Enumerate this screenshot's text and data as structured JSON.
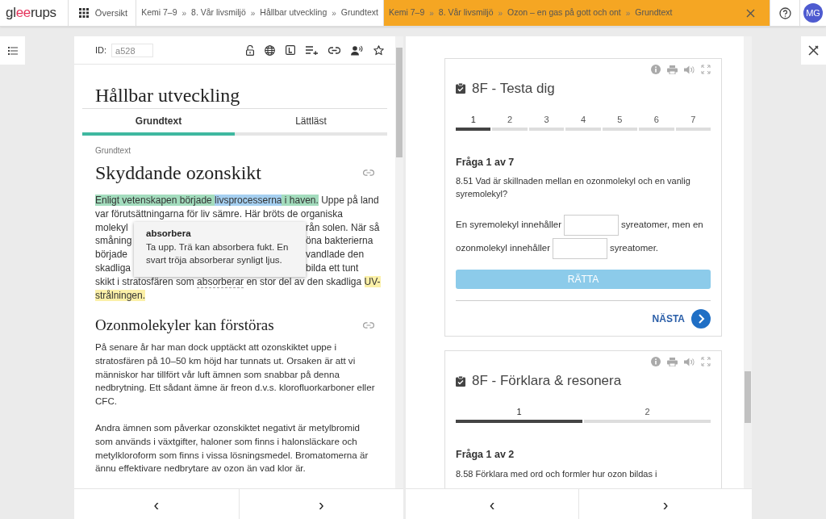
{
  "topbar": {
    "logo": [
      {
        "text": "gl",
        "accent": false
      },
      {
        "text": "ee",
        "accent": true
      },
      {
        "text": "rups",
        "accent": false
      }
    ],
    "overview": "Översikt",
    "trails": [
      {
        "active": false,
        "items": [
          {
            "kind": "crumb",
            "text": "Kemi 7–9"
          },
          {
            "kind": "sep",
            "text": "»"
          },
          {
            "kind": "crumb",
            "text": "8. Vår livsmiljö"
          },
          {
            "kind": "sep",
            "text": "»"
          },
          {
            "kind": "crumb",
            "text": "Hållbar utveckling"
          },
          {
            "kind": "sep",
            "text": "»"
          },
          {
            "kind": "crumb",
            "text": "Grundtext"
          }
        ]
      },
      {
        "active": true,
        "items": [
          {
            "kind": "crumb",
            "text": "Kemi 7–9"
          },
          {
            "kind": "sep",
            "text": "»"
          },
          {
            "kind": "crumb",
            "text": "8. Vår livsmiljö"
          },
          {
            "kind": "sep",
            "text": "»"
          },
          {
            "kind": "crumb",
            "text": "Ozon – en gas på gott och ont"
          },
          {
            "kind": "sep",
            "text": "»"
          },
          {
            "kind": "crumb",
            "text": "Grundtext"
          }
        ]
      }
    ],
    "avatar": "MG"
  },
  "reader": {
    "id_label": "ID:",
    "id_value": "a528",
    "title": "Hållbar utveckling",
    "tabs": [
      {
        "label": "Grundtext",
        "selected": true
      },
      {
        "label": "Lättläst",
        "selected": false
      }
    ],
    "section_label": "Grundtext",
    "heading_1": "Skyddande ozonskikt",
    "lines": [
      {
        "kind": "full",
        "segments": [
          {
            "kind": "highlight",
            "text": "Enligt vetenskapen började ",
            "color": "#a3dcbd"
          },
          {
            "kind": "highlight",
            "text": "livsprocesserna",
            "color": "#a5cff0"
          },
          {
            "kind": "highlight",
            "text": " i haven.",
            "color": "#a3dcbd"
          },
          {
            "kind": "plain",
            "text": " Uppe på land"
          }
        ]
      },
      {
        "kind": "full",
        "segments": [
          {
            "kind": "plain",
            "text": "var förutsättningarna för liv sämre. Här bröts de organiska"
          }
        ]
      },
      {
        "kind": "covered",
        "before": "molekyl",
        "after": "rån solen. När så"
      },
      {
        "kind": "covered",
        "before": "småning",
        "after": "öna bakterierna"
      },
      {
        "kind": "covered",
        "before": "började",
        "after": "vandlade den"
      },
      {
        "kind": "covered",
        "before": "skadliga",
        "after": "bilda ett tunt"
      },
      {
        "kind": "full",
        "segments": [
          {
            "kind": "plain",
            "text": "skikt i stratosfären som "
          },
          {
            "kind": "term",
            "text": "absorberar"
          },
          {
            "kind": "plain",
            "text": " en stor del av den skadliga "
          },
          {
            "kind": "highlight",
            "text": "UV-",
            "color": "#fbf0a8"
          }
        ]
      },
      {
        "kind": "full",
        "segments": [
          {
            "kind": "highlight",
            "text": "strålningen.",
            "color": "#fbf0a8"
          }
        ]
      }
    ],
    "tooltip": {
      "term": "absorbera",
      "text": "Ta upp. Trä kan absorbera fukt. En svart tröja absorberar synligt ljus."
    },
    "heading_2": "Ozonmolekyler kan förstöras",
    "paragraphs": [
      "På senare år har man dock upptäckt att ozonskiktet uppe i stratosfären på 10–50 km höjd har tunnats ut. Orsaken är att vi människor har tillfört vår luft ämnen som snabbar på denna nedbrytning. Ett sådant ämne är freon d.v.s. klorofluorkarboner eller CFC.",
      "Andra ämnen som påverkar ozonskiktet negativt är metylbromid som används i växtgifter, haloner som finns i halonsläckare och metylkloroform som finns i vissa lösningsmedel. Bromatomerna är ännu effektivare nedbrytare av ozon än vad klor är."
    ],
    "nav": {
      "prev": "‹",
      "next": "›"
    }
  },
  "exercises": {
    "cards": [
      {
        "title": "8F - Testa dig",
        "steps": [
          {
            "label": "1",
            "selected": true
          },
          {
            "label": "2",
            "selected": false
          },
          {
            "label": "3",
            "selected": false
          },
          {
            "label": "4",
            "selected": false
          },
          {
            "label": "5",
            "selected": false
          },
          {
            "label": "6",
            "selected": false
          },
          {
            "label": "7",
            "selected": false
          }
        ],
        "question_label": "Fråga 1 av 7",
        "question": "8.51 Vad är skillnaden mellan en ozonmolekyl och en vanlig syremolekyl?",
        "fill": [
          {
            "kind": "text",
            "text": "En syremolekyl innehåller"
          },
          {
            "kind": "blank"
          },
          {
            "kind": "text",
            "text": "syreatomer, men en"
          },
          {
            "kind": "break"
          },
          {
            "kind": "text",
            "text": "ozonmolekyl innehåller"
          },
          {
            "kind": "blank"
          },
          {
            "kind": "text",
            "text": "syreatomer."
          }
        ],
        "check": {
          "label": "RÄTTA",
          "disabled": true
        },
        "next": "NÄSTA"
      },
      {
        "title": "8F - Förklara & resonera",
        "steps": [
          {
            "label": "1",
            "selected": true
          },
          {
            "label": "2",
            "selected": false
          }
        ],
        "question_label": "Fråga 1 av 2",
        "question": "8.58 Förklara med ord och formler hur ozon bildas i"
      }
    ],
    "nav": {
      "prev": "‹",
      "next": "›"
    }
  }
}
